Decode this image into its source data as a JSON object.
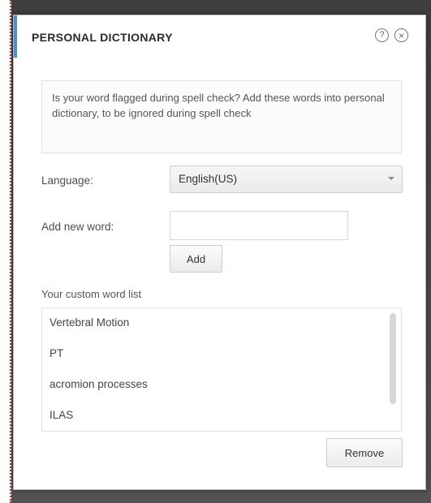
{
  "dialog": {
    "title": "PERSONAL DICTIONARY",
    "help_icon": "help-circle-icon",
    "close_icon": "close-circle-icon",
    "info_text": "Is your word flagged during spell check? Add these words into personal dictionary, to be ignored during spell check",
    "language_label": "Language:",
    "language_value": "English(US)",
    "new_word_label": "Add new word:",
    "new_word_value": "",
    "add_label": "Add",
    "list_heading": "Your custom word list",
    "words": [
      "Vertebral Motion",
      "PT",
      "acromion processes",
      "ILAS"
    ],
    "remove_label": "Remove",
    "colors": {
      "accent": "#4a90d9",
      "title": "#2b2b2b"
    }
  }
}
